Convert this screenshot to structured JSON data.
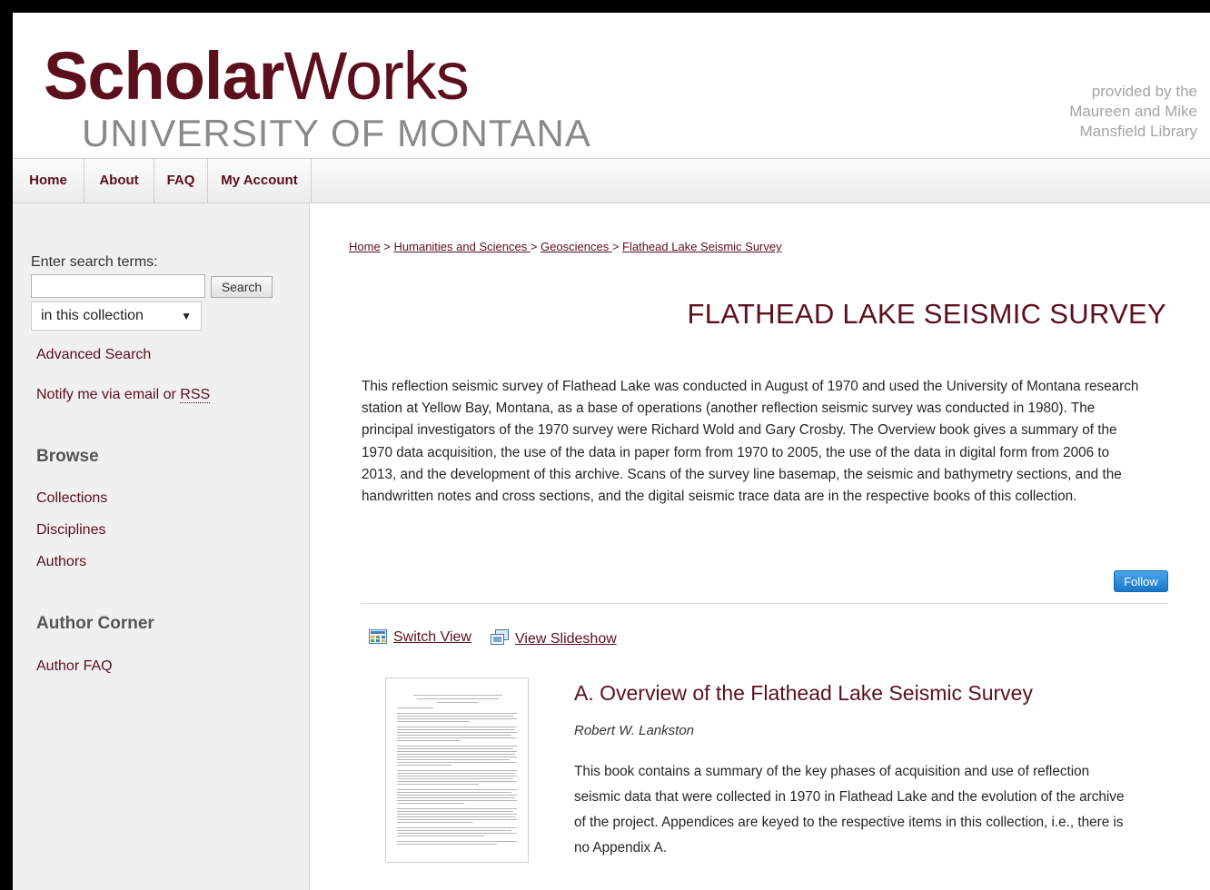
{
  "header": {
    "logo_bold": "Scholar",
    "logo_light": "Works",
    "logo_sub": "UNIVERSITY OF MONTANA",
    "provided_line1": "provided by the",
    "provided_line2": "Maureen and Mike",
    "provided_line3": "Mansfield Library"
  },
  "nav": {
    "items": [
      {
        "label": "Home"
      },
      {
        "label": "About"
      },
      {
        "label": "FAQ"
      },
      {
        "label": "My Account"
      }
    ]
  },
  "sidebar": {
    "search_label": "Enter search terms:",
    "search_value": "",
    "search_button": "Search",
    "scope_selected": "in this collection",
    "advanced_search": "Advanced Search",
    "notify_prefix": "Notify me via email or ",
    "notify_rss": "RSS",
    "browse_heading": "Browse",
    "browse_items": [
      "Collections",
      "Disciplines",
      "Authors"
    ],
    "author_corner_heading": "Author Corner",
    "author_faq": "Author FAQ"
  },
  "main": {
    "breadcrumb": {
      "items": [
        "Home",
        "Humanities and Sciences ",
        "Geosciences ",
        "Flathead Lake Seismic Survey"
      ],
      "separator": " > "
    },
    "title": "FLATHEAD LAKE SEISMIC SURVEY",
    "intro": "This reflection seismic survey of Flathead Lake was conducted in August of 1970 and used the University of Montana research station at Yellow Bay, Montana, as a base of operations (another reflection seismic survey was conducted in 1980). The principal investigators of the 1970 survey were Richard Wold and Gary Crosby. The Overview book gives a summary of the 1970 data acquisition, the use of the data in paper form from 1970 to 2005, the use of the data in digital form from 2006 to 2013, and the development of this archive. Scans of the survey line basemap, the seismic and bathymetry sections, and the handwritten notes and cross sections, and the digital seismic trace data are in the respective books of this collection.",
    "follow_button": "Follow",
    "switch_view": "Switch View",
    "view_slideshow": "View Slideshow",
    "item": {
      "title": "A. Overview of the Flathead Lake Seismic Survey",
      "author": "Robert W. Lankston",
      "description": "This book contains a summary of the key phases of acquisition and use of reflection seismic data that were collected in 1970 in Flathead Lake and the evolution of the archive of the project. Appendices are keyed to the respective items in this collection, i.e., there is no Appendix A."
    }
  },
  "colors": {
    "brand": "#5c0f1c",
    "follow": "#1c76c9",
    "sidebar_bg": "#f0f0f0"
  }
}
